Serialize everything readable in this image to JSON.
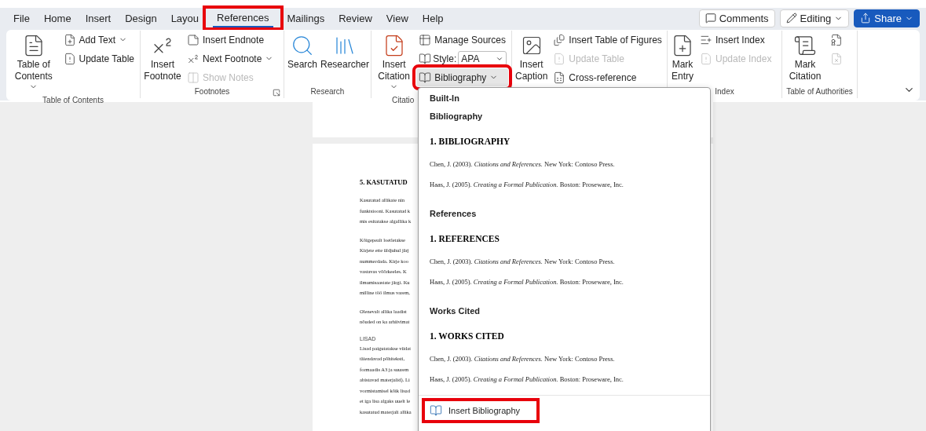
{
  "menu_tabs": [
    {
      "label": "File",
      "selected": false,
      "highlighted": false
    },
    {
      "label": "Home",
      "selected": false,
      "highlighted": false
    },
    {
      "label": "Insert",
      "selected": false,
      "highlighted": false
    },
    {
      "label": "Design",
      "selected": false,
      "highlighted": false
    },
    {
      "label": "Layou",
      "selected": false,
      "highlighted": false
    },
    {
      "label": "References",
      "selected": true,
      "highlighted": true
    },
    {
      "label": "Mailings",
      "selected": false,
      "highlighted": false
    },
    {
      "label": "Review",
      "selected": false,
      "highlighted": false
    },
    {
      "label": "View",
      "selected": false,
      "highlighted": false
    },
    {
      "label": "Help",
      "selected": false,
      "highlighted": false
    }
  ],
  "top_buttons": [
    {
      "kind": "comments",
      "label": "Comments"
    },
    {
      "kind": "editing",
      "label": "Editing"
    },
    {
      "kind": "share",
      "label": "Share"
    }
  ],
  "ribbon": {
    "groups": [
      {
        "label": "Table of Contents",
        "large": [
          {
            "label": "Table of Contents",
            "dropdown": true,
            "disabled": false
          }
        ],
        "small": [
          {
            "label": "Add Text",
            "dropdown": true,
            "disabled": false
          },
          {
            "label": "Update Table",
            "dropdown": false,
            "disabled": false
          }
        ]
      },
      {
        "label": "Footnotes",
        "launcher": true,
        "large": [
          {
            "label": "Insert Footnote",
            "dropdown": false,
            "disabled": false
          }
        ],
        "small": [
          {
            "label": "Insert Endnote",
            "dropdown": false,
            "disabled": false
          },
          {
            "label": "Next Footnote",
            "dropdown": true,
            "disabled": false
          },
          {
            "label": "Show Notes",
            "dropdown": false,
            "disabled": true
          }
        ]
      },
      {
        "label": "Research",
        "large": [
          {
            "label": "Search",
            "dropdown": false,
            "disabled": false
          },
          {
            "label": "Researcher",
            "dropdown": false,
            "disabled": false
          }
        ]
      },
      {
        "label": "Citatio",
        "large": [
          {
            "label": "Insert Citation",
            "dropdown": true,
            "disabled": false
          }
        ],
        "small": [
          {
            "label": "Manage Sources",
            "dropdown": false,
            "disabled": false
          }
        ],
        "style": {
          "label": "Style:",
          "value": "APA"
        },
        "bibliography": {
          "label": "Bibliography",
          "dropdown": true,
          "pressed": true,
          "highlighted": true
        }
      },
      {
        "large": [
          {
            "label": "Insert Caption",
            "dropdown": false,
            "disabled": false
          }
        ],
        "small": [
          {
            "label": "Insert Table of Figures",
            "dropdown": false,
            "disabled": false
          },
          {
            "label": "Update Table",
            "dropdown": false,
            "disabled": true
          },
          {
            "label": "Cross-reference",
            "dropdown": false,
            "disabled": false
          }
        ]
      },
      {
        "label": "Index",
        "large": [
          {
            "label": "Mark Entry",
            "dropdown": false,
            "disabled": false
          }
        ],
        "small": [
          {
            "label": "Insert Index",
            "dropdown": false,
            "disabled": false
          },
          {
            "label": "Update Index",
            "dropdown": false,
            "disabled": true
          }
        ]
      },
      {
        "label": "Table of Authorities",
        "large": [
          {
            "label": "Mark Citation",
            "dropdown": false,
            "disabled": false
          }
        ],
        "small": [
          {
            "dropdown": false,
            "disabled": false
          },
          {
            "dropdown": false,
            "disabled": true
          }
        ]
      }
    ]
  },
  "document": {
    "heading": "5. KASUTATUD",
    "blocks": [
      {
        "kind": "paragraph",
        "lines": [
          "Kasutatud allikate nin",
          "funktsiooni. Kasutatud k",
          "mis esitatakse algallika k"
        ]
      },
      {
        "kind": "paragraph",
        "lines": [
          "Kõigepealt loetletakse",
          "Kirjete ette üldjuhul järj",
          "nummerdada. Kirje koo",
          "vastavas võõrkeeles. K",
          "ilmumisaastate järgi. Ku",
          "milline töö ilmus varem,"
        ]
      },
      {
        "kind": "paragraph",
        "lines": [
          "Olenevalt allika laadist",
          "nõuded on ka arhiivimat"
        ]
      },
      {
        "kind": "subheading",
        "text": "LISAD"
      },
      {
        "kind": "paragraph",
        "lines": [
          "Lisad paigutatakse viidat",
          "täiendavad põhiteksti,",
          "formaadis A3 ja suurem",
          "abistavad materjalid). Li",
          "vormistamisel kõik lisad",
          "et iga lisa algaks uuelt le",
          "kasutatud materjali allika"
        ]
      }
    ]
  },
  "bibliography_menu": {
    "header": "Built-In",
    "gallery": [
      {
        "title": "Bibliography",
        "heading": "1. BIBLIOGRAPHY",
        "entries": [
          "Chen, J. (2003). *Citations and References.* New York: Contoso Press.",
          "Haas, J. (2005). *Creating a Formal Publication.* Boston: Proseware, Inc."
        ]
      },
      {
        "title": "References",
        "heading": "1. REFERENCES",
        "entries": [
          "Chen, J. (2003). *Citations and References.* New York: Contoso Press.",
          "Haas, J. (2005). *Creating a Formal Publication.* Boston: Proseware, Inc."
        ]
      },
      {
        "title": "Works Cited",
        "heading": "1. WORKS CITED",
        "entries": [
          "Chen, J. (2003). *Citations and References.* New York: Contoso Press.",
          "Haas, J. (2005). *Creating a Formal Publication.* Boston: Proseware, Inc."
        ]
      }
    ],
    "actions": [
      {
        "label": "Insert Bibliography",
        "highlighted": true
      }
    ]
  }
}
